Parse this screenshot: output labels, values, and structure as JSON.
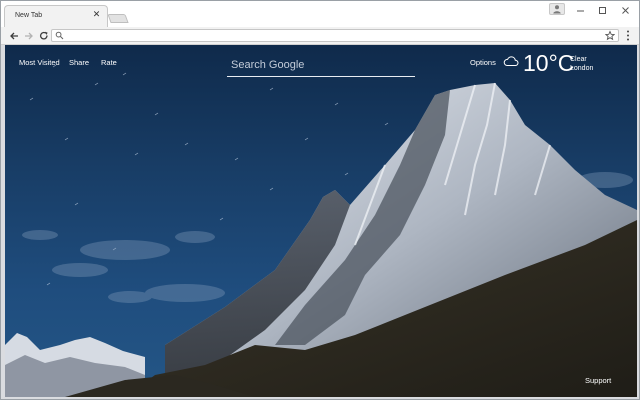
{
  "browser": {
    "tab_title": "New Tab",
    "tab_close_icon": "close-icon",
    "url": "",
    "icons": {
      "back": "arrow-left-icon",
      "forward": "arrow-right-icon",
      "reload": "reload-icon",
      "search": "search-icon",
      "bookmark": "star-icon",
      "menu": "kebab-menu-icon",
      "profile": "person-icon",
      "minimize": "minimize-icon",
      "maximize": "maximize-icon",
      "close": "close-icon"
    }
  },
  "page": {
    "nav": [
      "Most Visited",
      "Share",
      "Rate"
    ],
    "search": {
      "placeholder": "Search Google"
    },
    "options_label": "Options",
    "weather": {
      "icon": "cloud-icon",
      "temperature": "10",
      "unit": "°C",
      "condition": "Clear",
      "location": "London"
    },
    "support_label": "Support",
    "background": "snowy-mountain-peak-night-sky"
  },
  "colors": {
    "sky_top": "#0f2a4b",
    "sky_bottom": "#245686",
    "text": "#ffffff"
  }
}
